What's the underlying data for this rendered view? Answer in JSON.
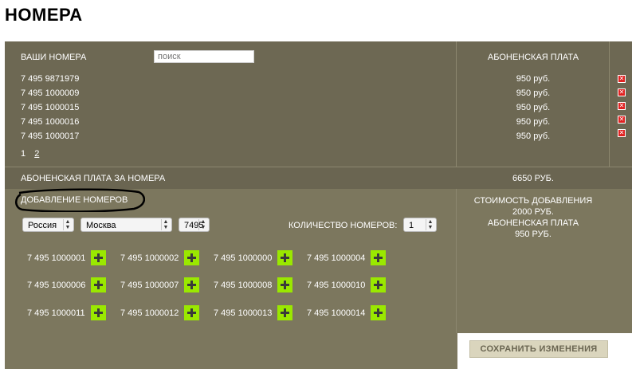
{
  "page": {
    "title": "НОМЕРА"
  },
  "numbers_panel": {
    "header_label": "ВАШИ НОМЕРА",
    "search_placeholder": "поиск",
    "fee_header": "АБОНЕНСКАЯ ПЛАТА",
    "rows": [
      {
        "number": "7 495 9871979",
        "fee": "950 руб."
      },
      {
        "number": "7 495 1000009",
        "fee": "950 руб."
      },
      {
        "number": "7 495 1000015",
        "fee": "950 руб."
      },
      {
        "number": "7 495 1000016",
        "fee": "950 руб."
      },
      {
        "number": "7 495 1000017",
        "fee": "950 руб."
      }
    ],
    "pagination": {
      "pages": [
        "1",
        "2"
      ],
      "current": "1"
    },
    "delete_icon": "close-icon",
    "delete_color": "#e0201f"
  },
  "summary": {
    "label": "АБОНЕНСКАЯ ПЛАТА ЗА НОМЕРА",
    "total": "6650 РУБ."
  },
  "add_panel": {
    "title": "ДОБАВЛЕНИЕ НОМЕРОВ",
    "country": "Россия",
    "city": "Москва",
    "code": "7495",
    "qty_label": "КОЛИЧЕСТВО НОМЕРОВ:",
    "qty_value": "1",
    "cost": {
      "add_label": "СТОИМОСТЬ ДОБАВЛЕНИЯ",
      "add_value": "2000 РУБ.",
      "fee_label": "АБОНЕНСКАЯ ПЛАТА",
      "fee_value": "950 РУБ."
    },
    "available": [
      [
        "7 495 1000001",
        "7 495 1000002",
        "7 495 1000000",
        "7 495 1000004"
      ],
      [
        "7 495 1000006",
        "7 495 1000007",
        "7 495 1000008",
        "7 495 1000010"
      ],
      [
        "7 495 1000011",
        "7 495 1000012",
        "7 495 1000013",
        "7 495 1000014"
      ]
    ],
    "add_icon": "plus-icon",
    "add_color": "#9ae800"
  },
  "actions": {
    "save_label": "СОХРАНИТЬ ИЗМЕНЕНИЯ"
  },
  "colors": {
    "panel_dark": "#6d6853",
    "panel_light": "#7c775e",
    "button_bg": "#dad5bd"
  }
}
